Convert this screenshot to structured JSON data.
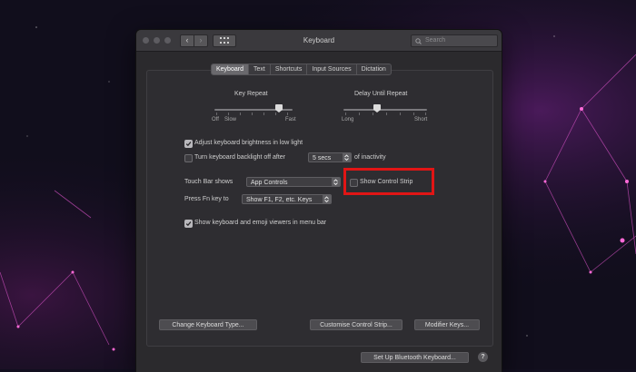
{
  "window": {
    "title": "Keyboard",
    "search_placeholder": "Search",
    "nav_back": "‹",
    "nav_forward": "›"
  },
  "tabs": [
    {
      "label": "Keyboard",
      "active": true
    },
    {
      "label": "Text",
      "active": false
    },
    {
      "label": "Shortcuts",
      "active": false
    },
    {
      "label": "Input Sources",
      "active": false
    },
    {
      "label": "Dictation",
      "active": false
    }
  ],
  "key_repeat": {
    "label": "Key Repeat",
    "min_label": "Off",
    "slow_label": "Slow",
    "max_label": "Fast"
  },
  "delay_until_repeat": {
    "label": "Delay Until Repeat",
    "min_label": "Long",
    "max_label": "Short"
  },
  "options": {
    "adjust_brightness": {
      "label": "Adjust keyboard brightness in low light",
      "checked": true
    },
    "backlight_off": {
      "label": "Turn keyboard backlight off after",
      "checked": false,
      "value": "5 secs",
      "suffix": "of inactivity"
    },
    "touch_bar": {
      "label": "Touch Bar shows",
      "value": "App Controls"
    },
    "show_control_strip": {
      "label": "Show Control Strip",
      "checked": false
    },
    "fn_key": {
      "label": "Press Fn key to",
      "value": "Show F1, F2, etc. Keys"
    },
    "show_viewers": {
      "label": "Show keyboard and emoji viewers in menu bar",
      "checked": true
    }
  },
  "buttons": {
    "change_type": "Change Keyboard Type...",
    "customise_strip": "Customise Control Strip...",
    "modifier_keys": "Modifier Keys...",
    "bluetooth": "Set Up Bluetooth Keyboard...",
    "help": "?"
  },
  "colors": {
    "highlight": "#e11515",
    "window_bg": "#2b2a2d"
  },
  "icons": {
    "grid": "grid-icon",
    "search": "search-icon",
    "checkmark": "checkmark-icon",
    "popup_arrows": "updown-arrows-icon"
  }
}
